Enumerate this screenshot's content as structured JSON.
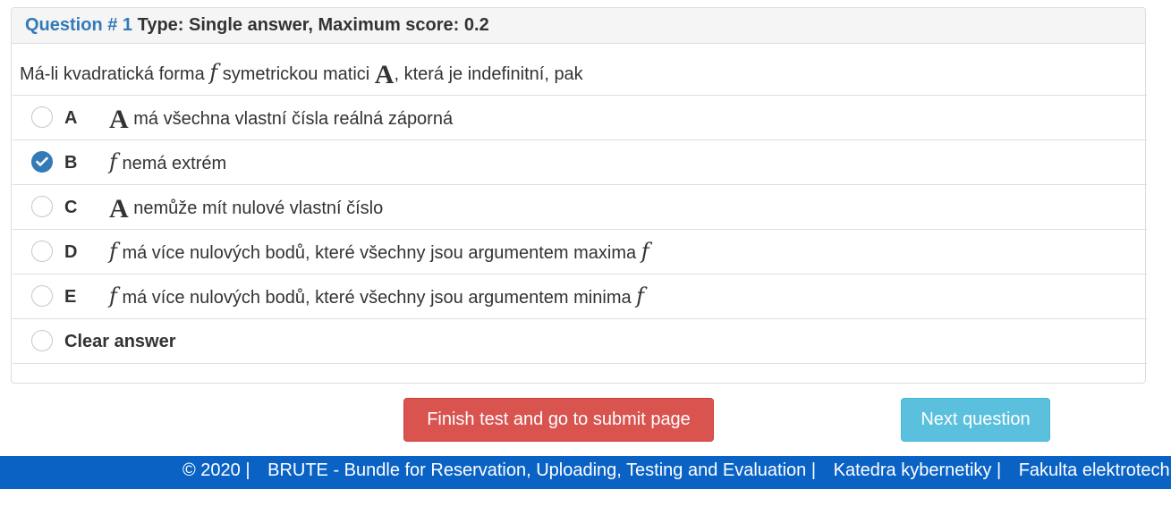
{
  "question": {
    "number_label": "Question # 1",
    "type_label": "Type: Single answer, Maximum score: 0.2",
    "text_before_f": "Má-li kvadratická forma",
    "math_f": "f",
    "text_middle": "symetrickou matici",
    "math_A": "A",
    "text_after": ", která je indefinitní, pak"
  },
  "options": [
    {
      "letter": "A",
      "math": "A",
      "text": "má všechna vlastní čísla reálná záporná",
      "math_suffix": "",
      "checked": false
    },
    {
      "letter": "B",
      "math": "f",
      "text": "nemá extrém",
      "math_suffix": "",
      "checked": true
    },
    {
      "letter": "C",
      "math": "A",
      "text": "nemůže mít nulové vlastní číslo",
      "math_suffix": "",
      "checked": false
    },
    {
      "letter": "D",
      "math": "f",
      "text": "má více nulových bodů, které všechny jsou argumentem maxima",
      "math_suffix": "f",
      "checked": false
    },
    {
      "letter": "E",
      "math": "f",
      "text": "má více nulových bodů, které všechny jsou argumentem minima",
      "math_suffix": "f",
      "checked": false
    }
  ],
  "clear_answer_label": "Clear answer",
  "buttons": {
    "finish_label": "Finish test and go to submit page",
    "next_label": "Next question"
  },
  "footer": {
    "copyright": "© 2020 |",
    "brute": "BRUTE - Bundle for Reservation, Uploading, Testing and Evaluation |",
    "katedra": "Katedra kybernetiky |",
    "fakulta": "Fakulta elektrotechnická"
  },
  "colors": {
    "accent": "#337ab7",
    "danger": "#d9534f",
    "info": "#5bc0de",
    "footer": "#0a63c4"
  }
}
